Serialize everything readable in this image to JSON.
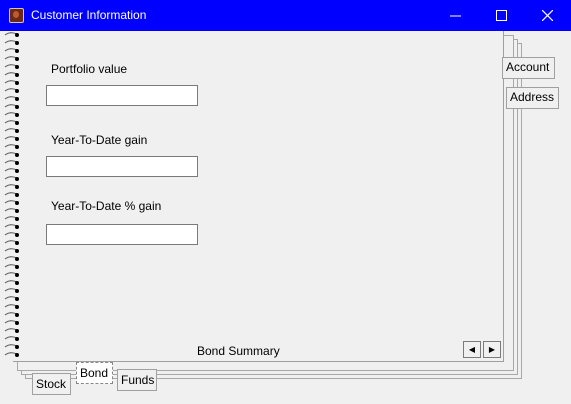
{
  "window": {
    "title": "Customer Information",
    "title_color": "#0000ff",
    "minimize_glyph": "—",
    "maximize_glyph": "☐",
    "close_glyph": "✕"
  },
  "fields": [
    {
      "label": "Portfolio value",
      "value": ""
    },
    {
      "label": "Year-To-Date gain",
      "value": ""
    },
    {
      "label": "Year-To-Date % gain",
      "value": ""
    }
  ],
  "side_tabs": [
    "Account",
    "Address"
  ],
  "bottom_tabs": [
    "Stock",
    "Bond",
    "Funds"
  ],
  "active_tab": "Bond",
  "status_label": "Bond Summary",
  "nav": {
    "prev_glyph": "◀",
    "next_glyph": "▶"
  }
}
